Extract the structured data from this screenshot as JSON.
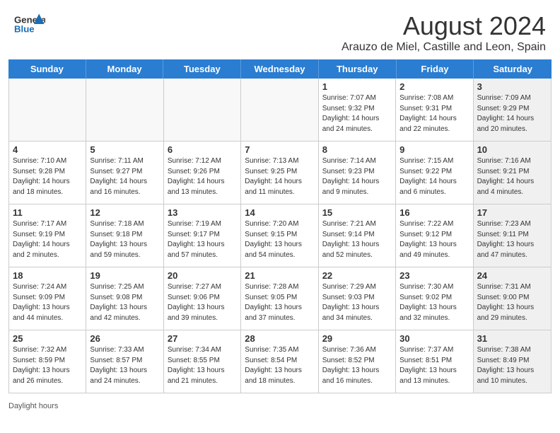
{
  "header": {
    "logo_general": "General",
    "logo_blue": "Blue",
    "main_title": "August 2024",
    "subtitle": "Arauzo de Miel, Castille and Leon, Spain"
  },
  "calendar": {
    "days": [
      "Sunday",
      "Monday",
      "Tuesday",
      "Wednesday",
      "Thursday",
      "Friday",
      "Saturday"
    ],
    "rows": [
      [
        {
          "day": "",
          "info": "",
          "empty": true
        },
        {
          "day": "",
          "info": "",
          "empty": true
        },
        {
          "day": "",
          "info": "",
          "empty": true
        },
        {
          "day": "",
          "info": "",
          "empty": true
        },
        {
          "day": "1",
          "info": "Sunrise: 7:07 AM\nSunset: 9:32 PM\nDaylight: 14 hours\nand 24 minutes."
        },
        {
          "day": "2",
          "info": "Sunrise: 7:08 AM\nSunset: 9:31 PM\nDaylight: 14 hours\nand 22 minutes."
        },
        {
          "day": "3",
          "info": "Sunrise: 7:09 AM\nSunset: 9:29 PM\nDaylight: 14 hours\nand 20 minutes.",
          "alt": true
        }
      ],
      [
        {
          "day": "4",
          "info": "Sunrise: 7:10 AM\nSunset: 9:28 PM\nDaylight: 14 hours\nand 18 minutes."
        },
        {
          "day": "5",
          "info": "Sunrise: 7:11 AM\nSunset: 9:27 PM\nDaylight: 14 hours\nand 16 minutes."
        },
        {
          "day": "6",
          "info": "Sunrise: 7:12 AM\nSunset: 9:26 PM\nDaylight: 14 hours\nand 13 minutes."
        },
        {
          "day": "7",
          "info": "Sunrise: 7:13 AM\nSunset: 9:25 PM\nDaylight: 14 hours\nand 11 minutes."
        },
        {
          "day": "8",
          "info": "Sunrise: 7:14 AM\nSunset: 9:23 PM\nDaylight: 14 hours\nand 9 minutes."
        },
        {
          "day": "9",
          "info": "Sunrise: 7:15 AM\nSunset: 9:22 PM\nDaylight: 14 hours\nand 6 minutes."
        },
        {
          "day": "10",
          "info": "Sunrise: 7:16 AM\nSunset: 9:21 PM\nDaylight: 14 hours\nand 4 minutes.",
          "alt": true
        }
      ],
      [
        {
          "day": "11",
          "info": "Sunrise: 7:17 AM\nSunset: 9:19 PM\nDaylight: 14 hours\nand 2 minutes."
        },
        {
          "day": "12",
          "info": "Sunrise: 7:18 AM\nSunset: 9:18 PM\nDaylight: 13 hours\nand 59 minutes."
        },
        {
          "day": "13",
          "info": "Sunrise: 7:19 AM\nSunset: 9:17 PM\nDaylight: 13 hours\nand 57 minutes."
        },
        {
          "day": "14",
          "info": "Sunrise: 7:20 AM\nSunset: 9:15 PM\nDaylight: 13 hours\nand 54 minutes."
        },
        {
          "day": "15",
          "info": "Sunrise: 7:21 AM\nSunset: 9:14 PM\nDaylight: 13 hours\nand 52 minutes."
        },
        {
          "day": "16",
          "info": "Sunrise: 7:22 AM\nSunset: 9:12 PM\nDaylight: 13 hours\nand 49 minutes."
        },
        {
          "day": "17",
          "info": "Sunrise: 7:23 AM\nSunset: 9:11 PM\nDaylight: 13 hours\nand 47 minutes.",
          "alt": true
        }
      ],
      [
        {
          "day": "18",
          "info": "Sunrise: 7:24 AM\nSunset: 9:09 PM\nDaylight: 13 hours\nand 44 minutes."
        },
        {
          "day": "19",
          "info": "Sunrise: 7:25 AM\nSunset: 9:08 PM\nDaylight: 13 hours\nand 42 minutes."
        },
        {
          "day": "20",
          "info": "Sunrise: 7:27 AM\nSunset: 9:06 PM\nDaylight: 13 hours\nand 39 minutes."
        },
        {
          "day": "21",
          "info": "Sunrise: 7:28 AM\nSunset: 9:05 PM\nDaylight: 13 hours\nand 37 minutes."
        },
        {
          "day": "22",
          "info": "Sunrise: 7:29 AM\nSunset: 9:03 PM\nDaylight: 13 hours\nand 34 minutes."
        },
        {
          "day": "23",
          "info": "Sunrise: 7:30 AM\nSunset: 9:02 PM\nDaylight: 13 hours\nand 32 minutes."
        },
        {
          "day": "24",
          "info": "Sunrise: 7:31 AM\nSunset: 9:00 PM\nDaylight: 13 hours\nand 29 minutes.",
          "alt": true
        }
      ],
      [
        {
          "day": "25",
          "info": "Sunrise: 7:32 AM\nSunset: 8:59 PM\nDaylight: 13 hours\nand 26 minutes."
        },
        {
          "day": "26",
          "info": "Sunrise: 7:33 AM\nSunset: 8:57 PM\nDaylight: 13 hours\nand 24 minutes."
        },
        {
          "day": "27",
          "info": "Sunrise: 7:34 AM\nSunset: 8:55 PM\nDaylight: 13 hours\nand 21 minutes."
        },
        {
          "day": "28",
          "info": "Sunrise: 7:35 AM\nSunset: 8:54 PM\nDaylight: 13 hours\nand 18 minutes."
        },
        {
          "day": "29",
          "info": "Sunrise: 7:36 AM\nSunset: 8:52 PM\nDaylight: 13 hours\nand 16 minutes."
        },
        {
          "day": "30",
          "info": "Sunrise: 7:37 AM\nSunset: 8:51 PM\nDaylight: 13 hours\nand 13 minutes."
        },
        {
          "day": "31",
          "info": "Sunrise: 7:38 AM\nSunset: 8:49 PM\nDaylight: 13 hours\nand 10 minutes.",
          "alt": true
        }
      ]
    ]
  },
  "footer": {
    "daylight_label": "Daylight hours"
  }
}
